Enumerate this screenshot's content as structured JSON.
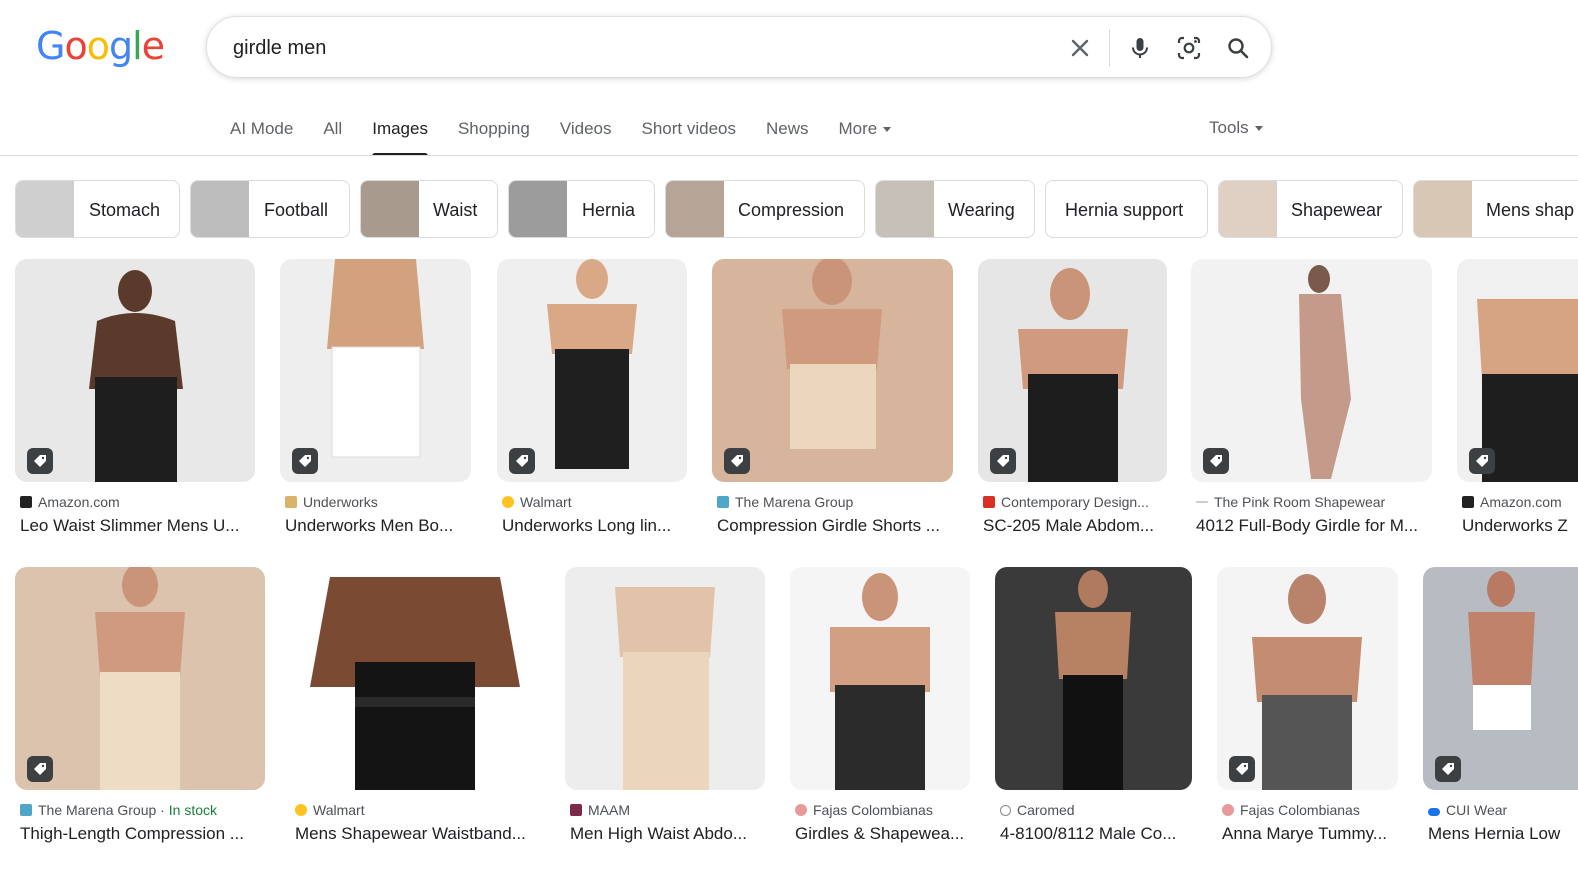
{
  "logo": {
    "letters": [
      "G",
      "o",
      "o",
      "g",
      "l",
      "e"
    ],
    "colors": [
      "#4285F4",
      "#EA4335",
      "#FBBC05",
      "#4285F4",
      "#34A853",
      "#EA4335"
    ]
  },
  "search": {
    "value": "girdle men",
    "icons": [
      "close-icon",
      "mic-icon",
      "lens-icon",
      "search-icon"
    ]
  },
  "tabs": [
    "AI Mode",
    "All",
    "Images",
    "Shopping",
    "Videos",
    "Short videos",
    "News",
    "More"
  ],
  "active_tab": "Images",
  "tools_label": "Tools",
  "chips": [
    "Stomach",
    "Football",
    "Waist",
    "Hernia",
    "Compression",
    "Wearing",
    "Hernia support",
    "Shapewear",
    "Mens shap"
  ],
  "row1": [
    {
      "source": "Amazon.com",
      "title": "Leo Waist Slimmer Mens U...",
      "bg": "#e8e8e8"
    },
    {
      "source": "Underworks",
      "title": "Underworks Men Bo...",
      "bg": "#eeeeee"
    },
    {
      "source": "Walmart",
      "title": "Underworks Long lin...",
      "bg": "#efefef"
    },
    {
      "source": "The Marena Group",
      "title": "Compression Girdle Shorts ...",
      "bg": "#d7b49c"
    },
    {
      "source": "Contemporary Design...",
      "title": "SC-205 Male Abdom...",
      "bg": "#e6e6e6"
    },
    {
      "source": "The Pink Room Shapewear",
      "title": "4012 Full-Body Girdle for M...",
      "bg": "#f2f2f2"
    },
    {
      "source": "Amazon.com",
      "title": "Underworks Z",
      "bg": "#f0f0f0"
    }
  ],
  "row2": [
    {
      "source": "The Marena Group",
      "stock": "In stock",
      "title": "Thigh-Length Compression ...",
      "bg": "#dcc3ad"
    },
    {
      "source": "Walmart",
      "title": "Mens Shapewear Waistband...",
      "bg": "#ffffff"
    },
    {
      "source": "MAAM",
      "title": "Men High Waist Abdo...",
      "bg": "#ededed"
    },
    {
      "source": "Fajas Colombianas",
      "title": "Girdles & Shapewea...",
      "bg": "#f5f5f5"
    },
    {
      "source": "Caromed",
      "title": "4-8100/8112 Male Co...",
      "bg": "#3a3a3a"
    },
    {
      "source": "Fajas Colombianas",
      "title": "Anna Marye Tummy...",
      "bg": "#f4f4f4"
    },
    {
      "source": "CUI Wear",
      "title": "Mens Hernia Low",
      "bg": "#b7bcc2"
    }
  ],
  "favicon_colors": {
    "Amazon.com": "#222222",
    "Underworks": "#d9b36a",
    "Walmart": "#ffc220",
    "The Marena Group": "#4fa6c8",
    "Contemporary Design...": "#d93025",
    "The Pink Room Shapewear": "#cccccc",
    "MAAM": "#7b2a4a",
    "Fajas Colombianas": "#e89a9a",
    "Caromed": "#8a8a8a",
    "CUI Wear": "#1a73e8"
  }
}
